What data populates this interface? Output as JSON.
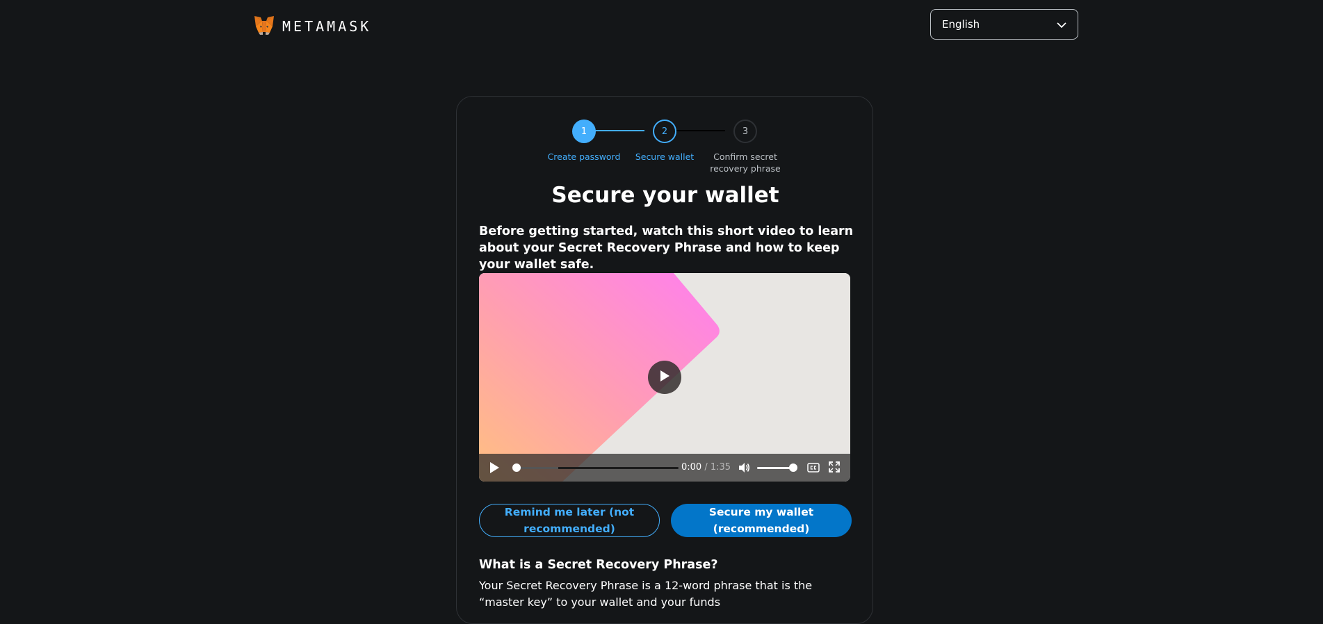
{
  "header": {
    "brand": "METAMASK",
    "language": "English"
  },
  "stepper": {
    "steps": [
      {
        "number": "1",
        "label": "Create password"
      },
      {
        "number": "2",
        "label": "Secure wallet"
      },
      {
        "number": "3",
        "label": "Confirm secret recovery phrase"
      }
    ]
  },
  "main": {
    "title": "Secure your wallet",
    "intro": "Before getting started, watch this short video to learn about your Secret Recovery Phrase and how to keep your wallet safe."
  },
  "video": {
    "current_time": "0:00",
    "separator": " / ",
    "duration": "1:35",
    "progress": 0,
    "volume": 1.0,
    "icons": [
      "play-icon",
      "volume-icon",
      "captions-icon",
      "fullscreen-icon"
    ]
  },
  "actions": {
    "remind_label": "Remind me later (not recommended)",
    "secure_label": "Secure my wallet (recommended)"
  },
  "faq": {
    "title": "What is a Secret Recovery Phrase?",
    "body": "Your Secret Recovery Phrase is a 12-word phrase that is the “master key” to your wallet and your funds"
  },
  "colors": {
    "background": "#141618",
    "accent": "#43aefc",
    "primary_button": "#0376c9",
    "border": "#2e3135"
  }
}
